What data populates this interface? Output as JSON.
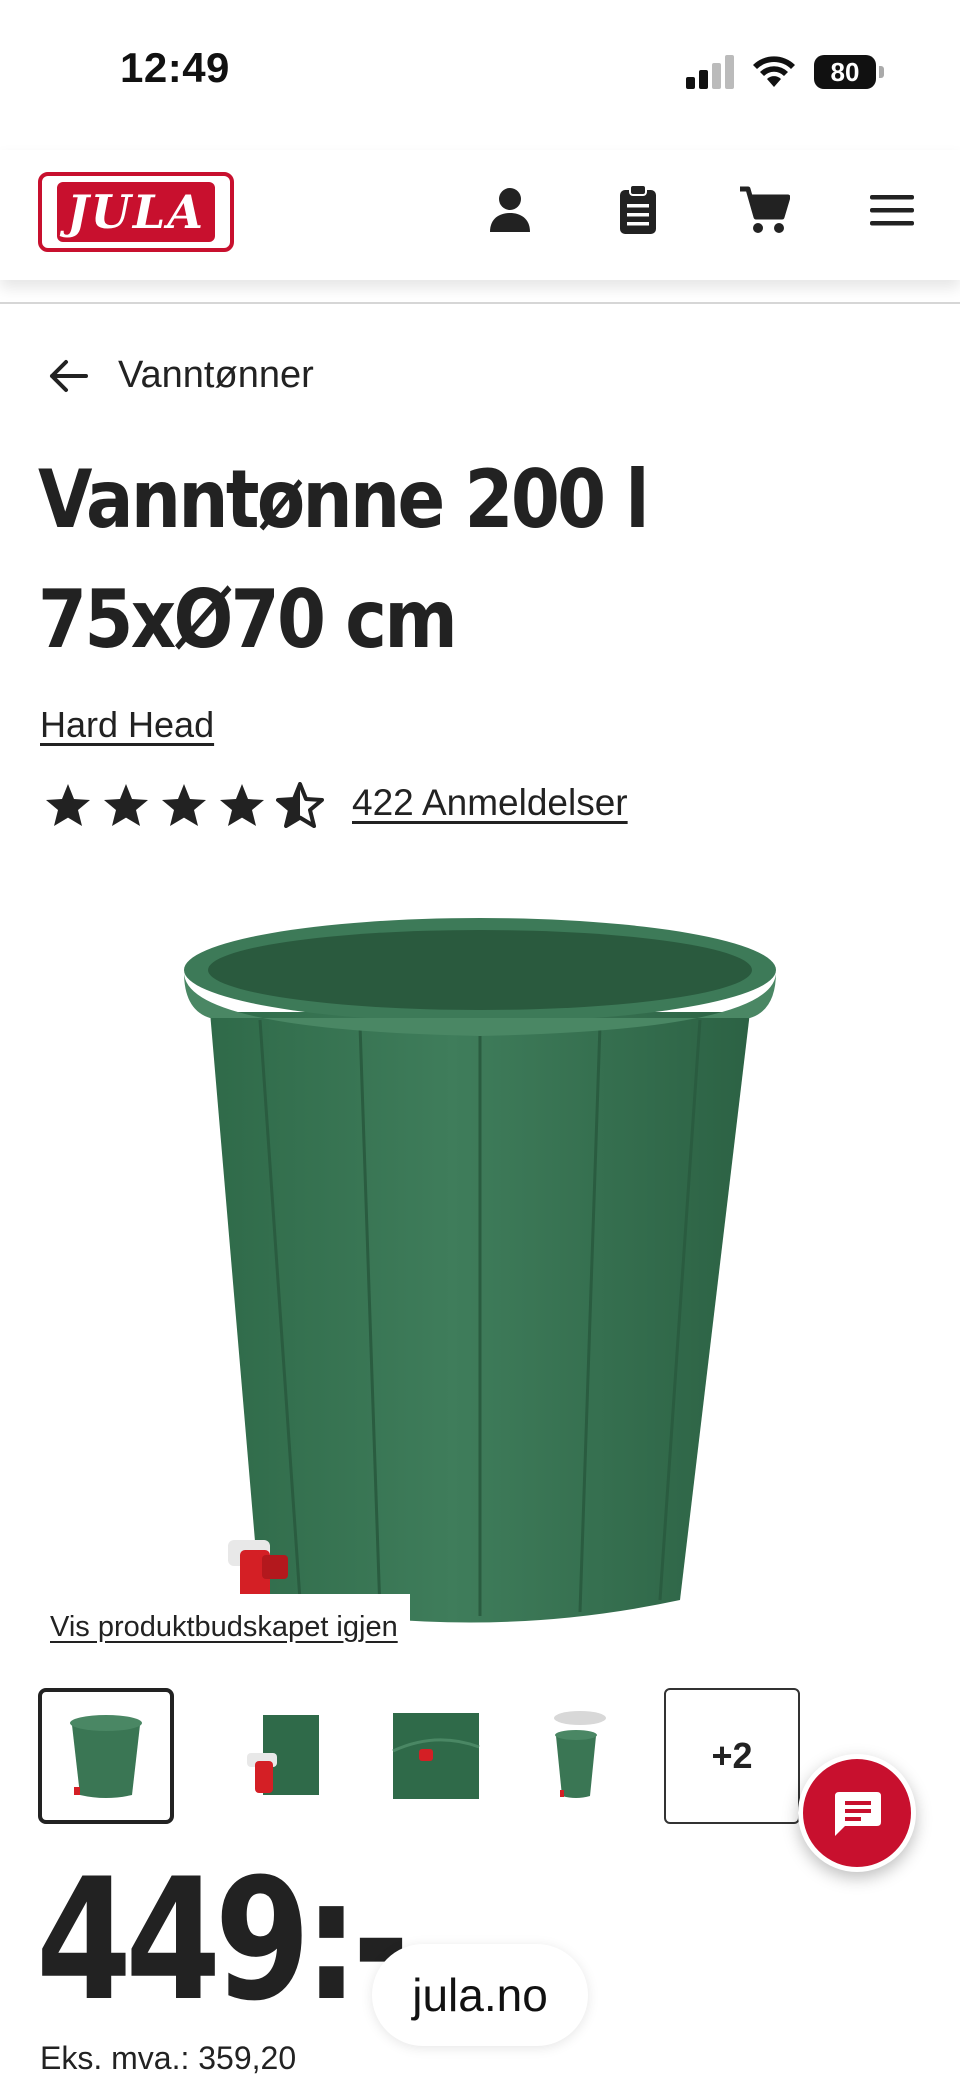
{
  "status_bar": {
    "time": "12:49",
    "battery": "80"
  },
  "header": {
    "logo": "JULA",
    "icons": [
      "user-icon",
      "clipboard-icon",
      "cart-icon",
      "menu-icon"
    ]
  },
  "breadcrumb": {
    "label": "Vanntønner"
  },
  "product": {
    "title": "Vanntønne 200 l 75xØ70 cm",
    "brand": "Hard Head",
    "rating": 4.5,
    "reviews_label": "422 Anmeldelser",
    "reshow_label": "Vis produktbudskapet igjen",
    "more_images_label": "+2",
    "price": "449:-",
    "price_ex_vat": "Eks. mva.: 359,20"
  },
  "url_pill": "jula.no",
  "colors": {
    "brand_red": "#c8102e",
    "barrel_green": "#3f7a5a",
    "text": "#222222"
  }
}
